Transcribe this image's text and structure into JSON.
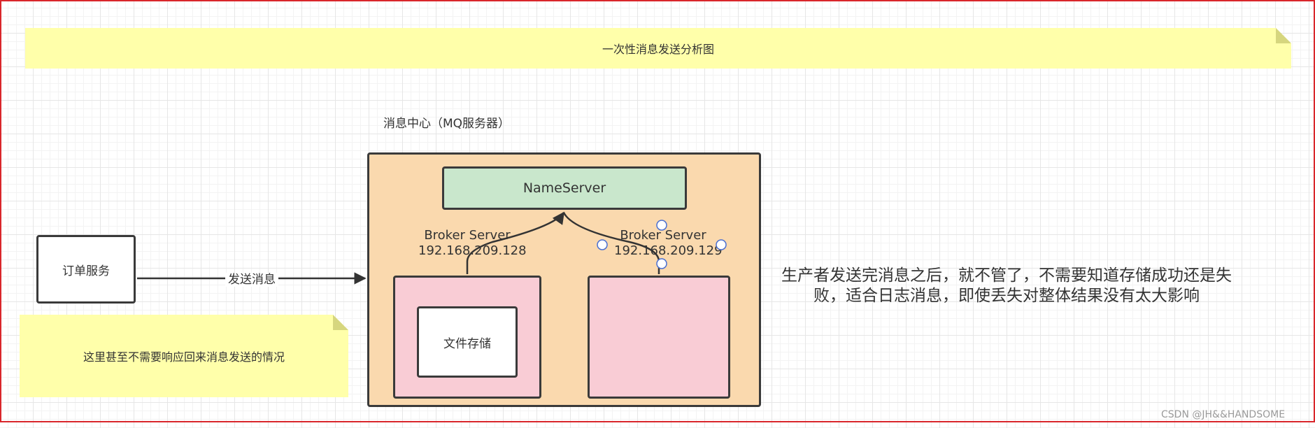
{
  "title_note": "一次性消息发送分析图",
  "mq_group_label": "消息中心（MQ服务器）",
  "nameserver_label": "NameServer",
  "broker1": {
    "name": "Broker Server",
    "ip": "192.168.209.128"
  },
  "broker2": {
    "name": "Broker Server",
    "ip": "192.168.209.129"
  },
  "order_service_label": "订单服务",
  "send_edge_label": "发送消息",
  "file_storage_label": "文件存储",
  "bottom_note": "这里甚至不需要响应回来消息发送的情况",
  "description": "生产者发送完消息之后，就不管了，不需要知道存储成功还是失败，适合日志消息，即使丢失对整体结果没有太大影响",
  "watermark": "CSDN @JH&&HANDSOME",
  "colors": {
    "note": "#ffffaa",
    "mq_container": "#fad9ae",
    "nameserver": "#c9e7cc",
    "broker_box": "#f9ccd5",
    "frame": "#d9262b"
  }
}
